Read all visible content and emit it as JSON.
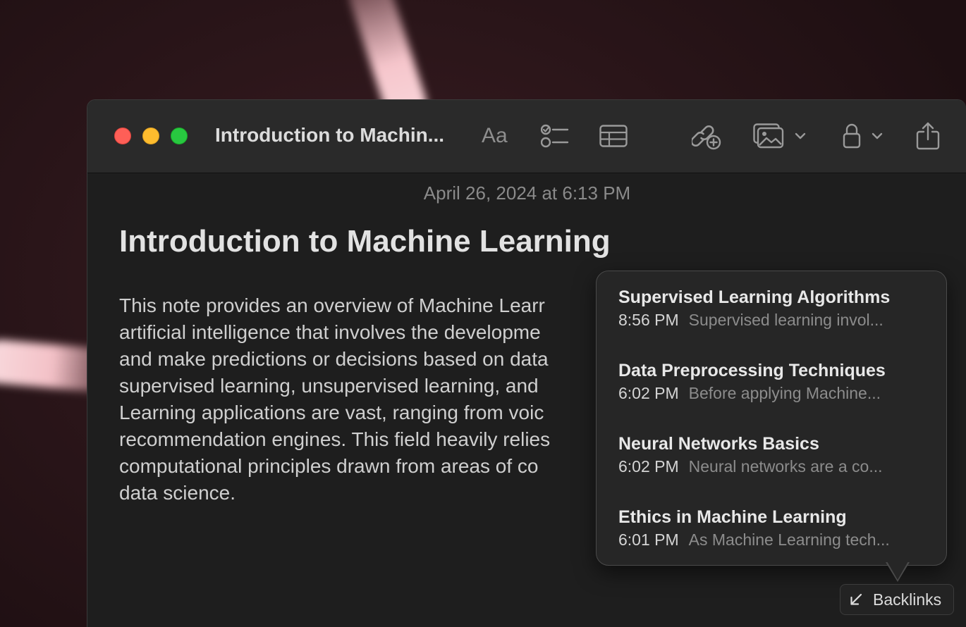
{
  "window": {
    "title": "Introduction to Machin..."
  },
  "toolbar": {
    "format_label": "Aa",
    "format_icon": "text-format-icon",
    "checklist_icon": "checklist-icon",
    "table_icon": "table-icon",
    "link_icon": "add-link-icon",
    "media_icon": "media-icon",
    "lock_icon": "lock-icon",
    "share_icon": "share-icon"
  },
  "note": {
    "date": "April 26, 2024 at 6:13 PM",
    "title": "Introduction to Machine Learning",
    "body_lines": [
      "This note provides an overview of Machine Learr",
      "artificial intelligence that involves the developme",
      "and make predictions or decisions based on data",
      "supervised learning, unsupervised learning, and",
      "Learning applications are vast, ranging from voic",
      "recommendation engines. This field heavily relies",
      "computational principles drawn from areas of co",
      "data science."
    ]
  },
  "backlinks": {
    "button_label": "Backlinks",
    "items": [
      {
        "title": "Supervised Learning Algorithms",
        "time": "8:56 PM",
        "snippet": "Supervised learning invol..."
      },
      {
        "title": "Data Preprocessing Techniques",
        "time": "6:02 PM",
        "snippet": "Before applying Machine..."
      },
      {
        "title": "Neural Networks Basics",
        "time": "6:02 PM",
        "snippet": "Neural networks are a co..."
      },
      {
        "title": "Ethics in Machine Learning",
        "time": "6:01 PM",
        "snippet": "As Machine Learning tech..."
      }
    ]
  },
  "colors": {
    "close": "#fe5f57",
    "minimize": "#febc2e",
    "maximize": "#28c840",
    "window_bg": "#1e1e1e",
    "titlebar_bg": "#2a2a2a"
  }
}
